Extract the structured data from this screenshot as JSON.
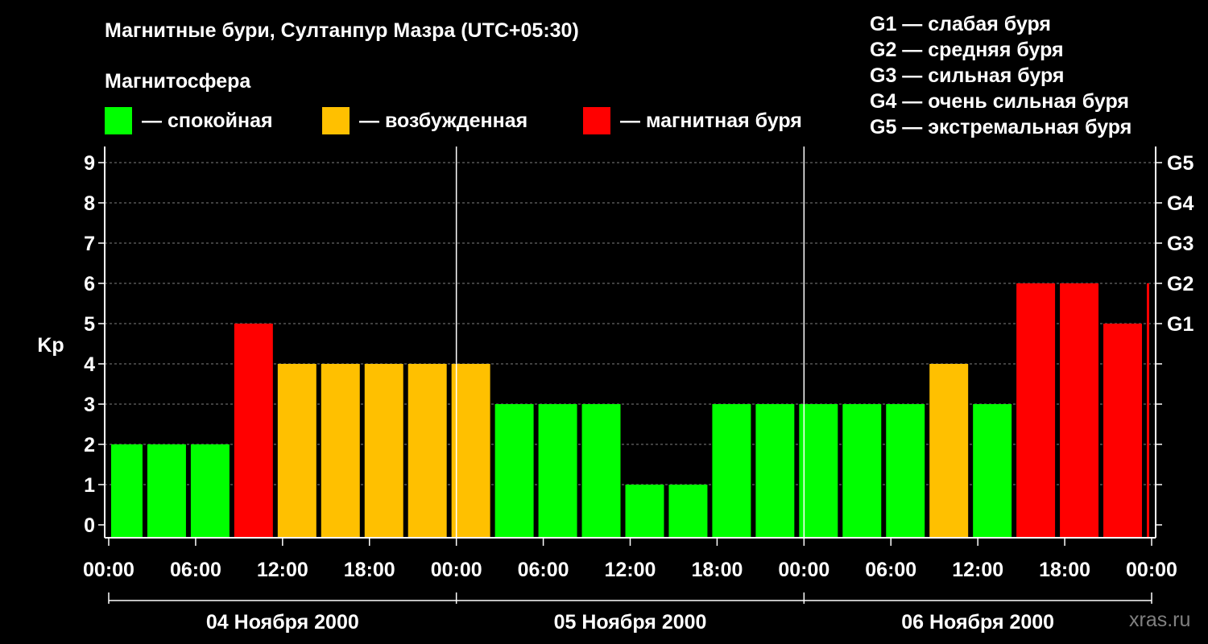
{
  "header": {
    "title": "Магнитные бури, Султанпур Мазра (UTC+05:30)",
    "subtitle": "Магнитосфера"
  },
  "legend": [
    {
      "label": "— спокойная",
      "color": "#00ff00"
    },
    {
      "label": "— возбужденная",
      "color": "#ffc000"
    },
    {
      "label": "— магнитная буря",
      "color": "#ff0000"
    }
  ],
  "gscale": [
    "G1 — слабая буря",
    "G2 — средняя буря",
    "G3 — сильная буря",
    "G4 — очень сильная буря",
    "G5 — экстремальная буря"
  ],
  "brand": "xras.ru",
  "chart_data": {
    "type": "bar",
    "ylabel": "Kp",
    "ylim": [
      0,
      9
    ],
    "yticks": [
      "0",
      "1",
      "2",
      "3",
      "4",
      "5",
      "6",
      "7",
      "8",
      "9"
    ],
    "right_labels": [
      {
        "level": 5,
        "label": "G1"
      },
      {
        "level": 6,
        "label": "G2"
      },
      {
        "level": 7,
        "label": "G3"
      },
      {
        "level": 8,
        "label": "G4"
      },
      {
        "level": 9,
        "label": "G5"
      }
    ],
    "xtick_labels": [
      "00:00",
      "06:00",
      "12:00",
      "18:00",
      "00:00",
      "06:00",
      "12:00",
      "18:00",
      "00:00",
      "06:00",
      "12:00",
      "18:00",
      "00:00"
    ],
    "days": [
      "04 Ноября 2000",
      "05 Ноября 2000",
      "06 Ноября 2000"
    ],
    "grid": true,
    "colors": {
      "quiet": "#00ff00",
      "active": "#ffc000",
      "storm": "#ff0000"
    },
    "bars": [
      {
        "start": "04 Ноября 2000 00:00",
        "end": "04 Ноября 2000 02:30",
        "kp": 2
      },
      {
        "start": "04 Ноября 2000 02:30",
        "end": "04 Ноября 2000 05:30",
        "kp": 2
      },
      {
        "start": "04 Ноября 2000 05:30",
        "end": "04 Ноября 2000 08:30",
        "kp": 2
      },
      {
        "start": "04 Ноября 2000 08:30",
        "end": "04 Ноября 2000 11:30",
        "kp": 5
      },
      {
        "start": "04 Ноября 2000 11:30",
        "end": "04 Ноября 2000 14:30",
        "kp": 4
      },
      {
        "start": "04 Ноября 2000 14:30",
        "end": "04 Ноября 2000 17:30",
        "kp": 4
      },
      {
        "start": "04 Ноября 2000 17:30",
        "end": "04 Ноября 2000 20:30",
        "kp": 4
      },
      {
        "start": "04 Ноября 2000 20:30",
        "end": "04 Ноября 2000 23:30",
        "kp": 4
      },
      {
        "start": "04 Ноября 2000 23:30",
        "end": "05 Ноября 2000 02:30",
        "kp": 4
      },
      {
        "start": "05 Ноября 2000 02:30",
        "end": "05 Ноября 2000 05:30",
        "kp": 3
      },
      {
        "start": "05 Ноября 2000 05:30",
        "end": "05 Ноября 2000 08:30",
        "kp": 3
      },
      {
        "start": "05 Ноября 2000 08:30",
        "end": "05 Ноября 2000 11:30",
        "kp": 3
      },
      {
        "start": "05 Ноября 2000 11:30",
        "end": "05 Ноября 2000 14:30",
        "kp": 1
      },
      {
        "start": "05 Ноября 2000 14:30",
        "end": "05 Ноября 2000 17:30",
        "kp": 1
      },
      {
        "start": "05 Ноября 2000 17:30",
        "end": "05 Ноября 2000 20:30",
        "kp": 3
      },
      {
        "start": "05 Ноября 2000 20:30",
        "end": "05 Ноября 2000 23:30",
        "kp": 3
      },
      {
        "start": "05 Ноября 2000 23:30",
        "end": "06 Ноября 2000 02:30",
        "kp": 3
      },
      {
        "start": "06 Ноября 2000 02:30",
        "end": "06 Ноября 2000 05:30",
        "kp": 3
      },
      {
        "start": "06 Ноября 2000 05:30",
        "end": "06 Ноября 2000 08:30",
        "kp": 3
      },
      {
        "start": "06 Ноября 2000 08:30",
        "end": "06 Ноября 2000 11:30",
        "kp": 4
      },
      {
        "start": "06 Ноября 2000 11:30",
        "end": "06 Ноября 2000 14:30",
        "kp": 3
      },
      {
        "start": "06 Ноября 2000 14:30",
        "end": "06 Ноября 2000 17:30",
        "kp": 6
      },
      {
        "start": "06 Ноября 2000 17:30",
        "end": "06 Ноября 2000 20:30",
        "kp": 6
      },
      {
        "start": "06 Ноября 2000 20:30",
        "end": "06 Ноября 2000 23:30",
        "kp": 5
      },
      {
        "start": "06 Ноября 2000 23:30",
        "end": "07 Ноября 2000 00:00",
        "kp": 6
      }
    ]
  }
}
